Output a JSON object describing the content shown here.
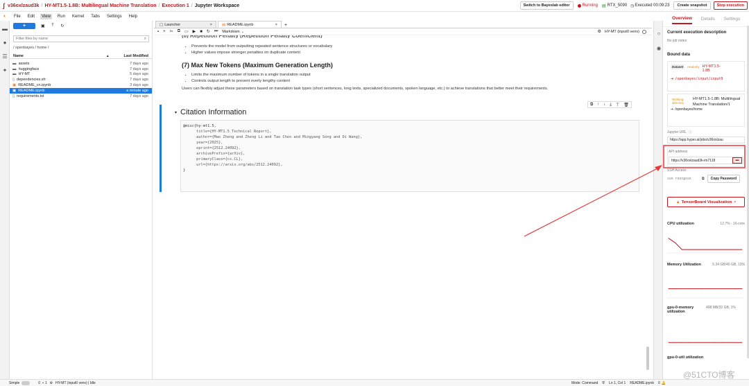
{
  "topbar": {
    "logo_glyph": "ʃ",
    "breadcrumb_project": "v36oxlzaud3k",
    "breadcrumb_model": "HY-MT1.5-1.8B: Multilingual Machine Translation",
    "breadcrumb_execution": "Execution 1",
    "breadcrumb_workspace": "Jupyter Workspace",
    "sep": "/",
    "switch_button": "Switch to Bayeslab editor",
    "running_status": "Running",
    "gpu": "RTX_5090",
    "executed": "Executed 00:09:23",
    "snapshot_button": "Create snapshot",
    "stop_button": "Stop execution",
    "accent_color": "#c4161c"
  },
  "menubar": {
    "items": [
      "File",
      "Edit",
      "View",
      "Run",
      "Kernel",
      "Tabs",
      "Settings",
      "Help"
    ],
    "active": "View"
  },
  "filebrowser": {
    "new_button": "+",
    "filter_placeholder": "Filter files by name",
    "path": "/ openbayes / home /",
    "col_name": "Name",
    "col_modified": "Last Modified",
    "files": [
      {
        "icon": "folder-icon",
        "name": "assets",
        "modified": "7 days ago",
        "selected": false
      },
      {
        "icon": "folder-icon",
        "name": "huggingface",
        "modified": "7 days ago",
        "selected": false
      },
      {
        "icon": "folder-icon",
        "name": "HY-MT",
        "modified": "5 days ago",
        "selected": false
      },
      {
        "icon": "file-icon",
        "name": "dependencies.sh",
        "modified": "7 days ago",
        "selected": false
      },
      {
        "icon": "notebook-icon",
        "name": "README_cn.ipynb",
        "modified": "3 days ago",
        "selected": false
      },
      {
        "icon": "notebook-icon",
        "name": "README.ipynb",
        "modified": "a minute ago",
        "selected": true
      },
      {
        "icon": "file-icon",
        "name": "requirements.txt",
        "modified": "7 days ago",
        "selected": false
      }
    ]
  },
  "notebook": {
    "tabs": [
      {
        "label": "Launcher",
        "active": false
      },
      {
        "label": "README.ipynb",
        "active": true
      }
    ],
    "add_tab": "+",
    "cell_type": "Markdown",
    "kernel": "HY-MT (input0 venv)",
    "partial_heading": "(6) Repetition Penalty (Repetition Penalty Coefficient)",
    "bullets_1": [
      "Prevents the model from outputting repeated sentence structures or vocabulary",
      "Higher values impose stronger penalties on duplicate content"
    ],
    "heading_7": "(7) Max New Tokens (Maximum Generation Length)",
    "bullets_2": [
      "Limits the maximum number of tokens in a single translation output",
      "Controls output length to prevent overly lengthy content"
    ],
    "paragraph": "Users can flexibly adjust these parameters based on translation task types (short sentences, long texts, specialized documents, spoken language, etc.) to achieve translations that better meet their requirements.",
    "citation_heading": "Citation Information",
    "code_lines": [
      "@misc{hy-mt1.5,",
      "      title={HY-MT1.5 Technical Report},",
      "      author={Mao Zheng and Zheng Li and Tao Chen and Mingyang Song and Di Wang},",
      "      year={2025},",
      "      eprint={2512.24092},",
      "      archivePrefix={arXiv},",
      "      primaryClass={cs.CL},",
      "      url={https://arxiv.org/abs/2512.24092},",
      "}"
    ]
  },
  "rpanel": {
    "tabs": [
      "Overview",
      "Details",
      "Settings"
    ],
    "active_tab": "Overview",
    "exec_desc_title": "Current execution description",
    "exec_desc_value": "No job notes",
    "bound_data_title": "Bound data",
    "dataset_chip": "Dataset",
    "readonly_chip": "readonly",
    "dataset_name": "HY-MT1.5-1.8B",
    "dataset_path": "/openbayes/input/input0",
    "working_chip": "Working directory",
    "working_name": "HY-MT1.5-1.8B: Multilingual Machine Translation/1",
    "working_path": "/openbayes/home",
    "jupyter_url_label": "Jupyter URL",
    "jupyter_url": "https://app.hyper.ai/jobs/v36oxlzau",
    "api_label": "API address",
    "api_value": "https://v36oxlzaud3k-im7118",
    "ssh_label": "SSH Access",
    "ssh_value": "ssh root@ssh",
    "copy_password": "Copy Password",
    "tensorboard": "TensorBoard Visualization",
    "cpu_label": "CPU utilization",
    "cpu_value": "12.7% - 16-core",
    "cpu_series": [
      28,
      18,
      3,
      3,
      3,
      3,
      3,
      3,
      3,
      3,
      3,
      3
    ],
    "mem_label": "Memory Utilization",
    "mem_value": "5.34 GB/40 GB, 13%",
    "mem_series": [
      13,
      13,
      13,
      13,
      13,
      13,
      13,
      13,
      13,
      13,
      13,
      13
    ],
    "gpu_mem_label": "gpu-0-memory utilization",
    "gpu_mem_value": "498 MB/32 GB, 1%",
    "gpu_mem_series": [
      1,
      1,
      1,
      1,
      1,
      1,
      1,
      1,
      1,
      1,
      1,
      1
    ],
    "gpu_util_label": "gpu-0-util utilization"
  },
  "statusbar": {
    "mode_label": "Simple",
    "kernel_count": "0",
    "terminal_count": "1",
    "kernel_info": "HY-MT (input0 venv) | Idle",
    "mode": "Mode: Command",
    "position": "Ln 1, Col 1",
    "filename": "README.ipynb",
    "right_count": "0"
  },
  "watermark": "@51CTO博客"
}
